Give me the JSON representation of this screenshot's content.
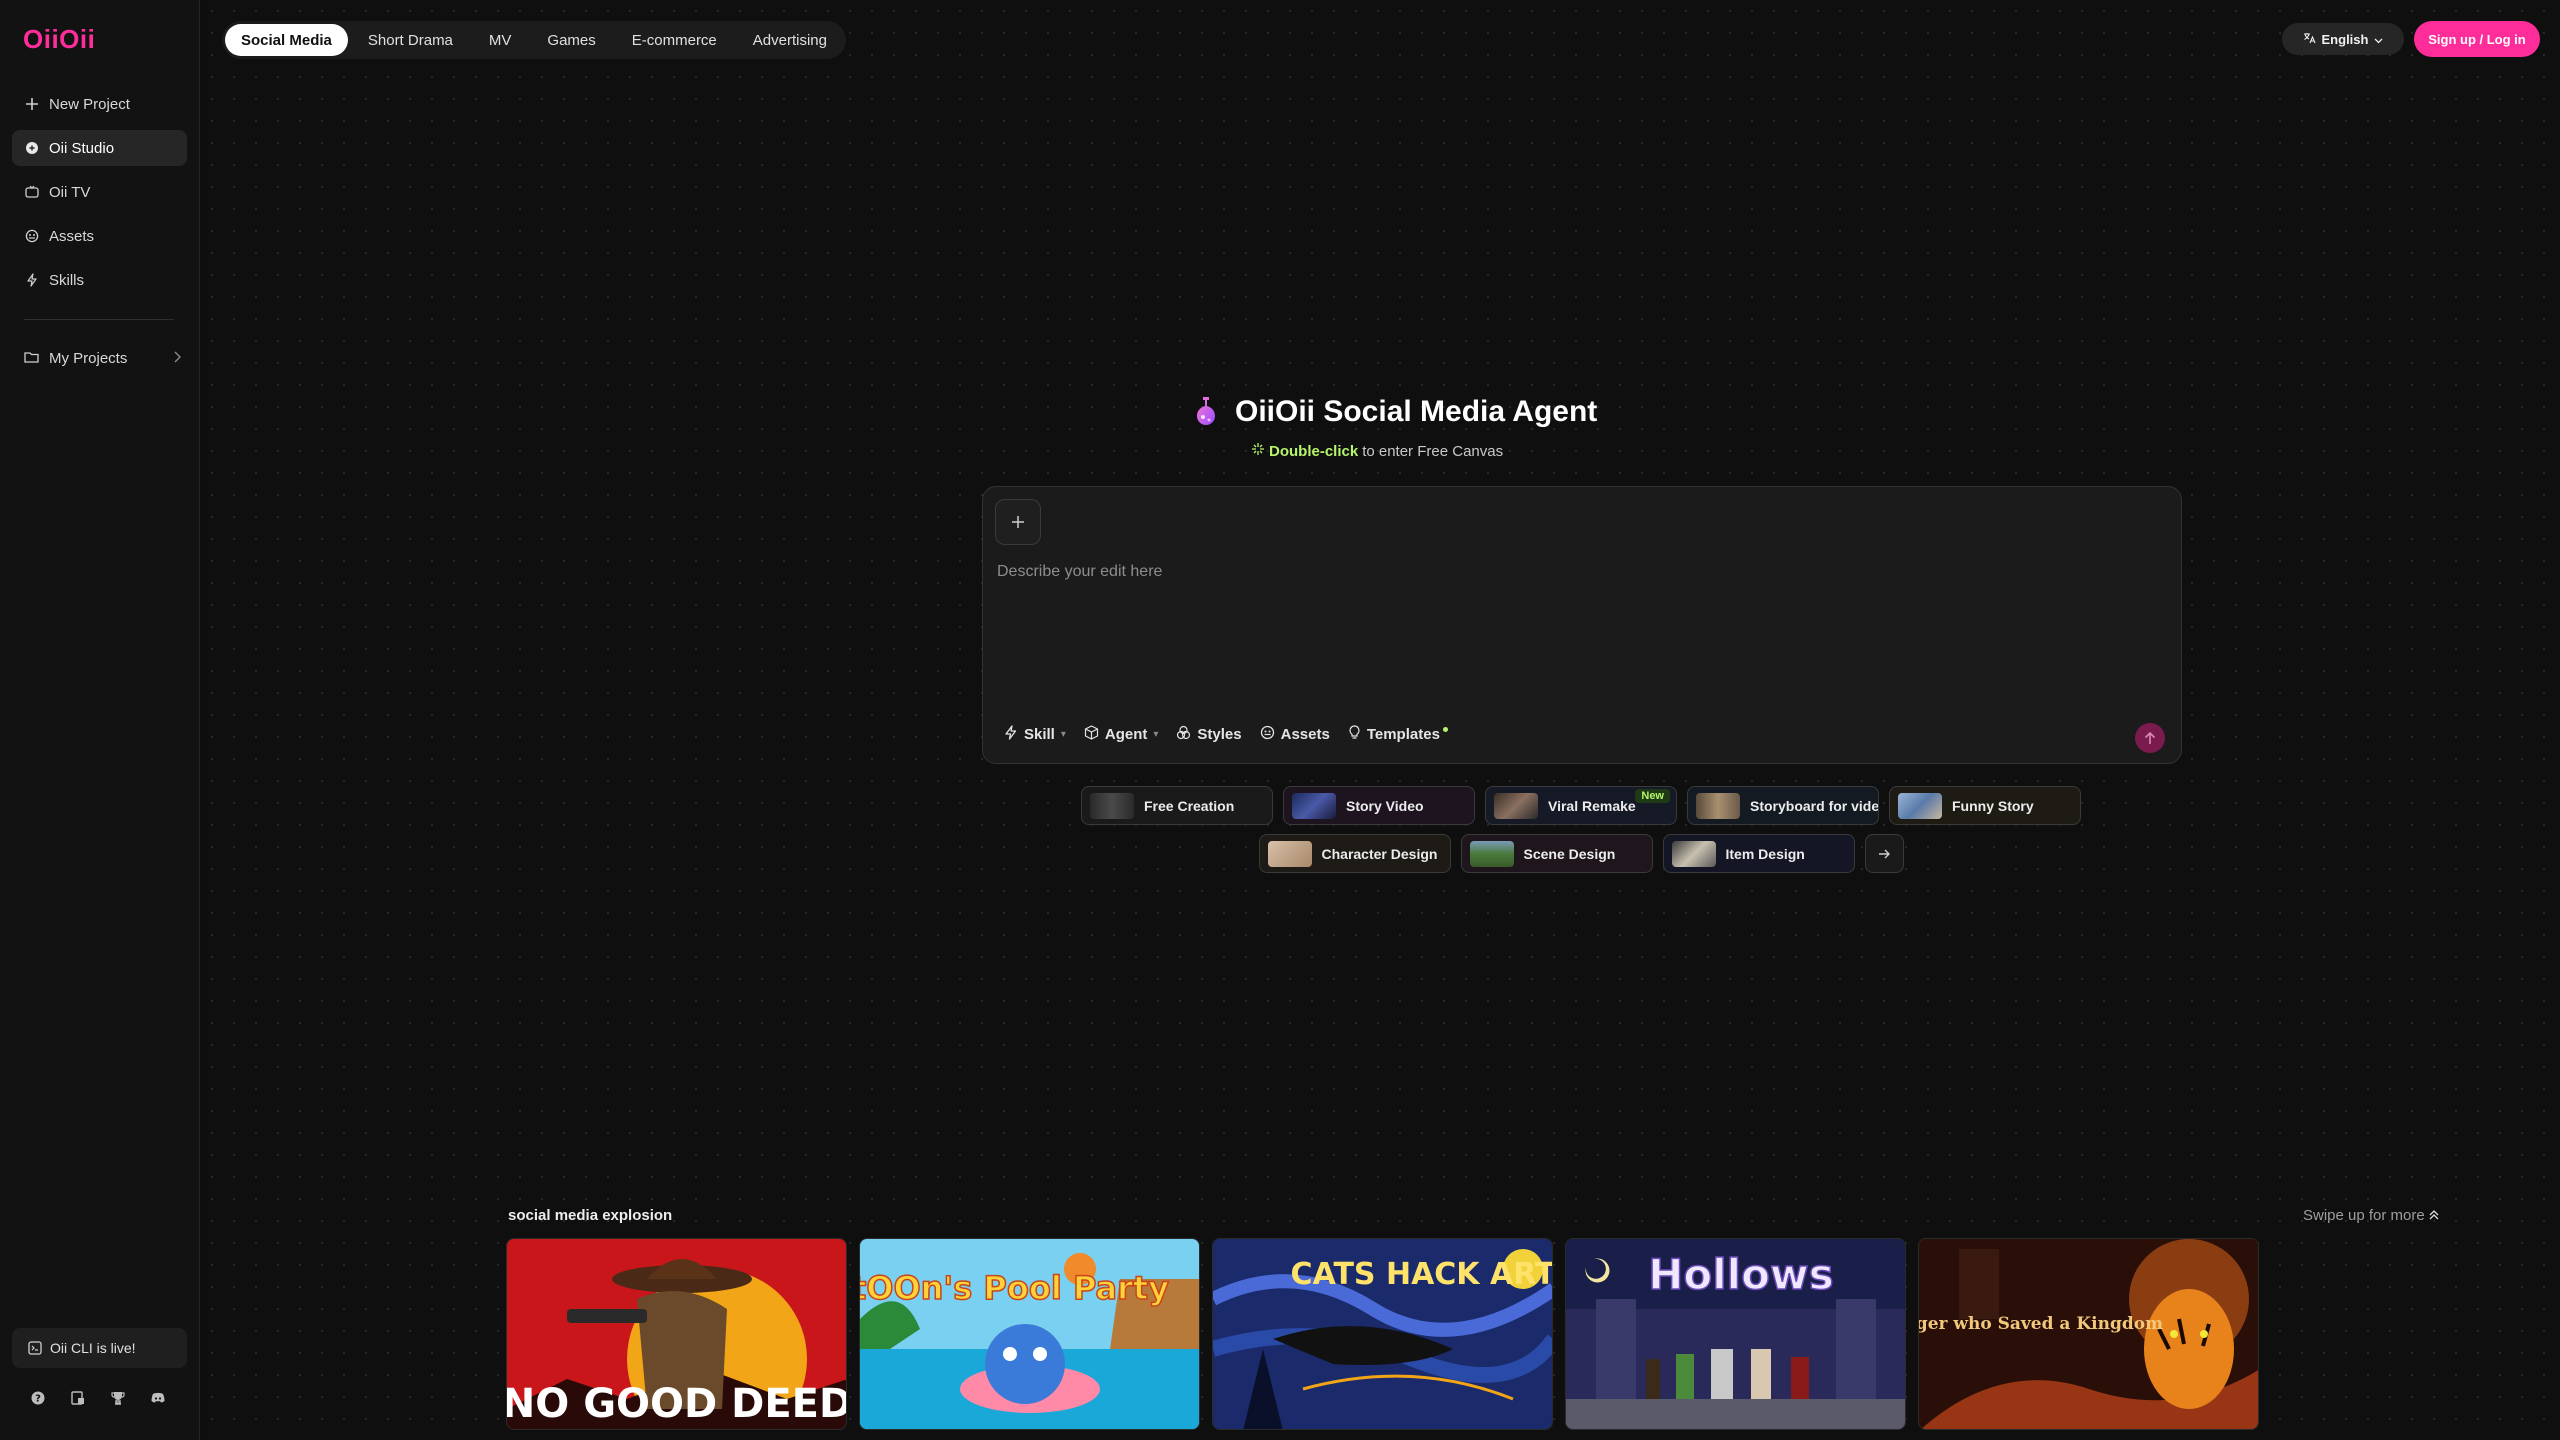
{
  "brand": {
    "logo_text": "OiiOii",
    "accent": "#ff2d9a",
    "highlight": "#b6f56b"
  },
  "sidebar": {
    "items": [
      {
        "label": "New Project",
        "icon": "plus-icon",
        "active": false
      },
      {
        "label": "Oii Studio",
        "icon": "studio-icon",
        "active": true
      },
      {
        "label": "Oii TV",
        "icon": "tv-icon",
        "active": false
      },
      {
        "label": "Assets",
        "icon": "assets-icon",
        "active": false
      },
      {
        "label": "Skills",
        "icon": "skills-icon",
        "active": false
      }
    ],
    "projects_label": "My Projects",
    "cli_banner": "Oii CLI is live!",
    "bottom_icons": [
      "help-icon",
      "docs-icon",
      "trophy-icon",
      "discord-icon"
    ]
  },
  "header": {
    "tabs": [
      "Social Media",
      "Short Drama",
      "MV",
      "Games",
      "E-commerce",
      "Advertising"
    ],
    "active_tab": "Social Media",
    "language": "English",
    "signup_label": "Sign up / Log in"
  },
  "hero": {
    "title": "OiiOii Social Media Agent",
    "sub_highlight": "Double-click",
    "sub_rest": "to enter Free Canvas"
  },
  "composer": {
    "placeholder": "Describe your edit here",
    "tools": [
      {
        "label": "Skill",
        "icon": "lightning-icon",
        "caret": true
      },
      {
        "label": "Agent",
        "icon": "cube-icon",
        "caret": true
      },
      {
        "label": "Styles",
        "icon": "palette-icon",
        "caret": false
      },
      {
        "label": "Assets",
        "icon": "assets-icon",
        "caret": false
      },
      {
        "label": "Templates",
        "icon": "bulb-icon",
        "caret": false
      }
    ]
  },
  "chips": {
    "row1": [
      {
        "label": "Free Creation",
        "tint": "#1a1a1a",
        "thumb": "#3b3b3b"
      },
      {
        "label": "Story Video",
        "tint": "#1d1420",
        "thumb": "#2e3e7a"
      },
      {
        "label": "Viral Remake",
        "tint": "#161a26",
        "thumb": "#6b5a4a",
        "badge": "New"
      },
      {
        "label": "Storyboard for vide",
        "tint": "#141a22",
        "thumb": "#8a7a5a"
      },
      {
        "label": "Funny Story",
        "tint": "#1e1b14",
        "thumb": "#7a94b8"
      }
    ],
    "row2": [
      {
        "label": "Character Design",
        "tint": "#1e1a16",
        "thumb": "#c8a98a"
      },
      {
        "label": "Scene Design",
        "tint": "#1e161c",
        "thumb": "#4a7a3a"
      },
      {
        "label": "Item Design",
        "tint": "#141626",
        "thumb": "#b0a89a"
      }
    ]
  },
  "gallery": {
    "title": "social media explosion",
    "more": "Swipe up for more",
    "cards": [
      {
        "caption": "NO GOOD DEED",
        "theme": "western"
      },
      {
        "caption": "tOOn's Pool Party",
        "theme": "pool"
      },
      {
        "caption": "CATS HACK ART",
        "theme": "starry"
      },
      {
        "caption": "Hollows",
        "theme": "castle"
      },
      {
        "caption": "The Tiger who Saved a Kingdom",
        "theme": "tiger"
      }
    ]
  }
}
